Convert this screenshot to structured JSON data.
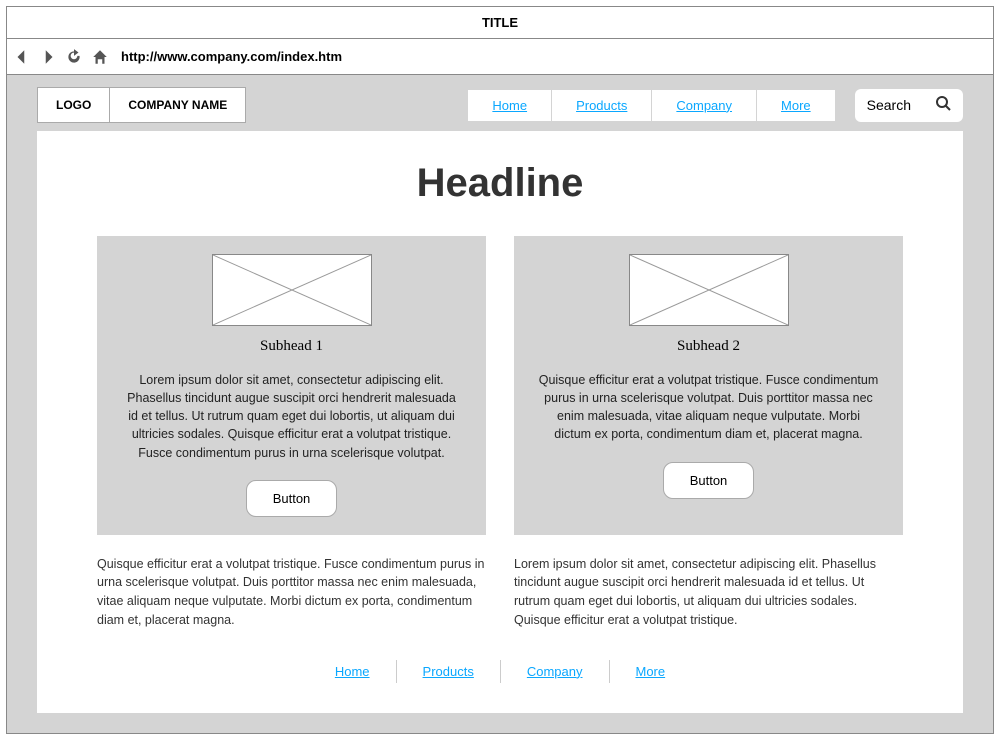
{
  "browser": {
    "title": "TITLE",
    "url": "http://www.company.com/index.htm"
  },
  "header": {
    "logo_text": "LOGO",
    "company_name": "COMPANY NAME",
    "nav": [
      "Home",
      "Products",
      "Company",
      "More"
    ],
    "search_placeholder": "Search"
  },
  "main": {
    "headline": "Headline",
    "cards": [
      {
        "subhead": "Subhead 1",
        "body": "Lorem ipsum dolor sit amet, consectetur adipiscing elit. Phasellus tincidunt augue suscipit orci hendrerit malesuada id et tellus. Ut rutrum quam eget dui lobortis, ut aliquam dui ultricies sodales. Quisque efficitur erat a volutpat tristique. Fusce condimentum purus in urna scelerisque volutpat.",
        "button": "Button"
      },
      {
        "subhead": "Subhead 2",
        "body": "Quisque efficitur erat a volutpat tristique. Fusce condimentum purus in urna scelerisque volutpat. Duis porttitor massa nec enim malesuada, vitae aliquam neque vulputate. Morbi dictum ex porta, condimentum diam et, placerat magna.",
        "button": "Button"
      }
    ],
    "texts": [
      "Quisque efficitur erat a volutpat tristique. Fusce condimentum purus in urna scelerisque volutpat. Duis porttitor massa nec enim malesuada, vitae aliquam neque vulputate. Morbi dictum ex porta, condimentum diam et, placerat magna.",
      "Lorem ipsum dolor sit amet, consectetur adipiscing elit. Phasellus tincidunt augue suscipit orci hendrerit malesuada id et tellus. Ut rutrum quam eget dui lobortis, ut aliquam dui ultricies sodales. Quisque efficitur erat a volutpat tristique."
    ]
  },
  "footer": {
    "nav": [
      "Home",
      "Products",
      "Company",
      "More"
    ]
  }
}
